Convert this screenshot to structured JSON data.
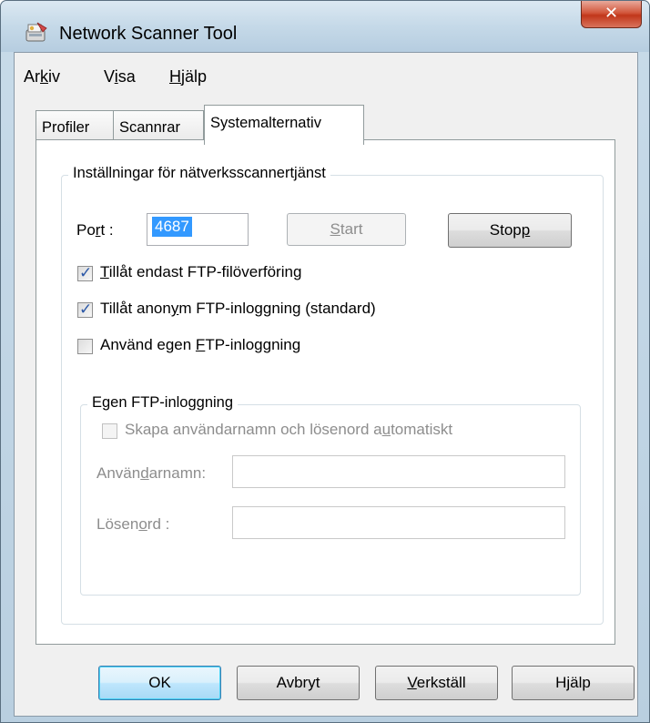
{
  "window": {
    "title": "Network Scanner Tool",
    "app_icon": "scanner-app-icon",
    "close_icon": "close-icon"
  },
  "menu": [
    {
      "pre": "Ar",
      "key": "k",
      "post": "iv"
    },
    {
      "pre": "V",
      "key": "i",
      "post": "sa"
    },
    {
      "pre": "",
      "key": "H",
      "post": "jälp"
    }
  ],
  "tabs": [
    "Profiler",
    "Scannrar",
    "Systemalternativ"
  ],
  "active_tab": "Systemalternativ",
  "service_group": {
    "label": "Inställningar för nätverksscannertjänst",
    "port_label_pre": "Po",
    "port_label_key": "r",
    "port_label_post": "t :",
    "port_value": "4687",
    "start_pre": "",
    "start_key": "S",
    "start_post": "tart",
    "stop_pre": "Stop",
    "stop_key": "p",
    "stop_post": "",
    "checkbox_ftp_only": {
      "pre": "",
      "key": "T",
      "post": "illåt endast FTP-filöverföring",
      "checked": true
    },
    "checkbox_anon": {
      "pre": "Tillåt anon",
      "key": "y",
      "post": "m FTP-inloggning (standard)",
      "checked": true
    },
    "checkbox_custom": {
      "pre": "Använd egen ",
      "key": "F",
      "post": "TP-inloggning",
      "checked": false
    }
  },
  "custom_group": {
    "label": "Egen FTP-inloggning",
    "checkbox_auto": {
      "pre": "Skapa användarnamn och lösenord a",
      "key": "u",
      "post": "tomatiskt",
      "checked": false
    },
    "username_pre": "Använ",
    "username_key": "d",
    "username_post": "arnamn:",
    "username_value": "",
    "password_pre": "Lösen",
    "password_key": "o",
    "password_post": "rd :",
    "password_value": ""
  },
  "buttons": {
    "ok": "OK",
    "cancel": "Avbryt",
    "apply_pre": "",
    "apply_key": "V",
    "apply_post": "erkställ",
    "help": "Hjälp"
  },
  "colors": {
    "selection": "#3399ff",
    "checkmark": "#2a57a6",
    "close_button": "#c1361a"
  }
}
